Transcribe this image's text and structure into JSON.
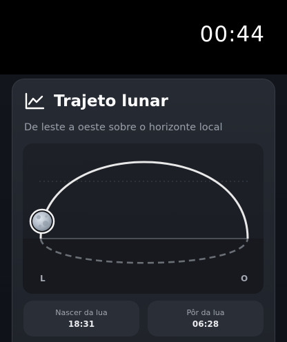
{
  "status": {
    "time": "00:44"
  },
  "card": {
    "title": "Trajeto lunar",
    "subtitle": "De leste a oeste sobre o horizonte local",
    "icon": "line-chart-icon"
  },
  "path": {
    "east_label": "L",
    "west_label": "O",
    "moon_icon": "moon-icon"
  },
  "moonrise": {
    "label": "Nascer da lua",
    "value": "18:31"
  },
  "moonset": {
    "label": "Pôr da lua",
    "value": "06:28"
  },
  "colors": {
    "background": "#000000",
    "card": "#23272e",
    "arc": "#e6e6e6",
    "below_horizon": "#6e7278"
  }
}
